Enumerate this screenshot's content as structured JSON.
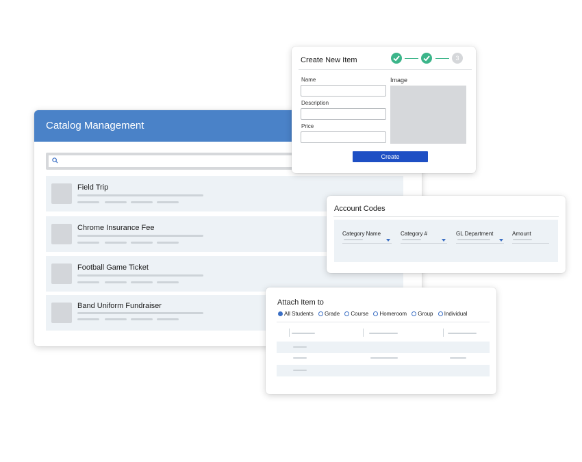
{
  "catalog": {
    "title": "Catalog Management",
    "items": [
      {
        "label": "Field Trip"
      },
      {
        "label": "Chrome Insurance Fee"
      },
      {
        "label": "Football Game Ticket"
      },
      {
        "label": "Band Uniform Fundraiser"
      }
    ]
  },
  "create_item": {
    "title": "Create New Item",
    "steps": [
      "",
      "",
      "3"
    ],
    "name_label": "Name",
    "description_label": "Description",
    "price_label": "Price",
    "image_label": "Image",
    "create_button": "Create"
  },
  "account_codes": {
    "title": "Account Codes",
    "columns": [
      "Category Name",
      "Category #",
      "GL Department",
      "Amount"
    ]
  },
  "attach": {
    "title": "Attach Item to",
    "options": [
      "All Students",
      "Grade",
      "Course",
      "Homeroom",
      "Group",
      "Individual"
    ],
    "selected": "All Students"
  },
  "colors": {
    "header_blue": "#4a82c8",
    "button_blue": "#1e4fc4",
    "step_green": "#3cb58a",
    "row_bg": "#edf2f6"
  }
}
